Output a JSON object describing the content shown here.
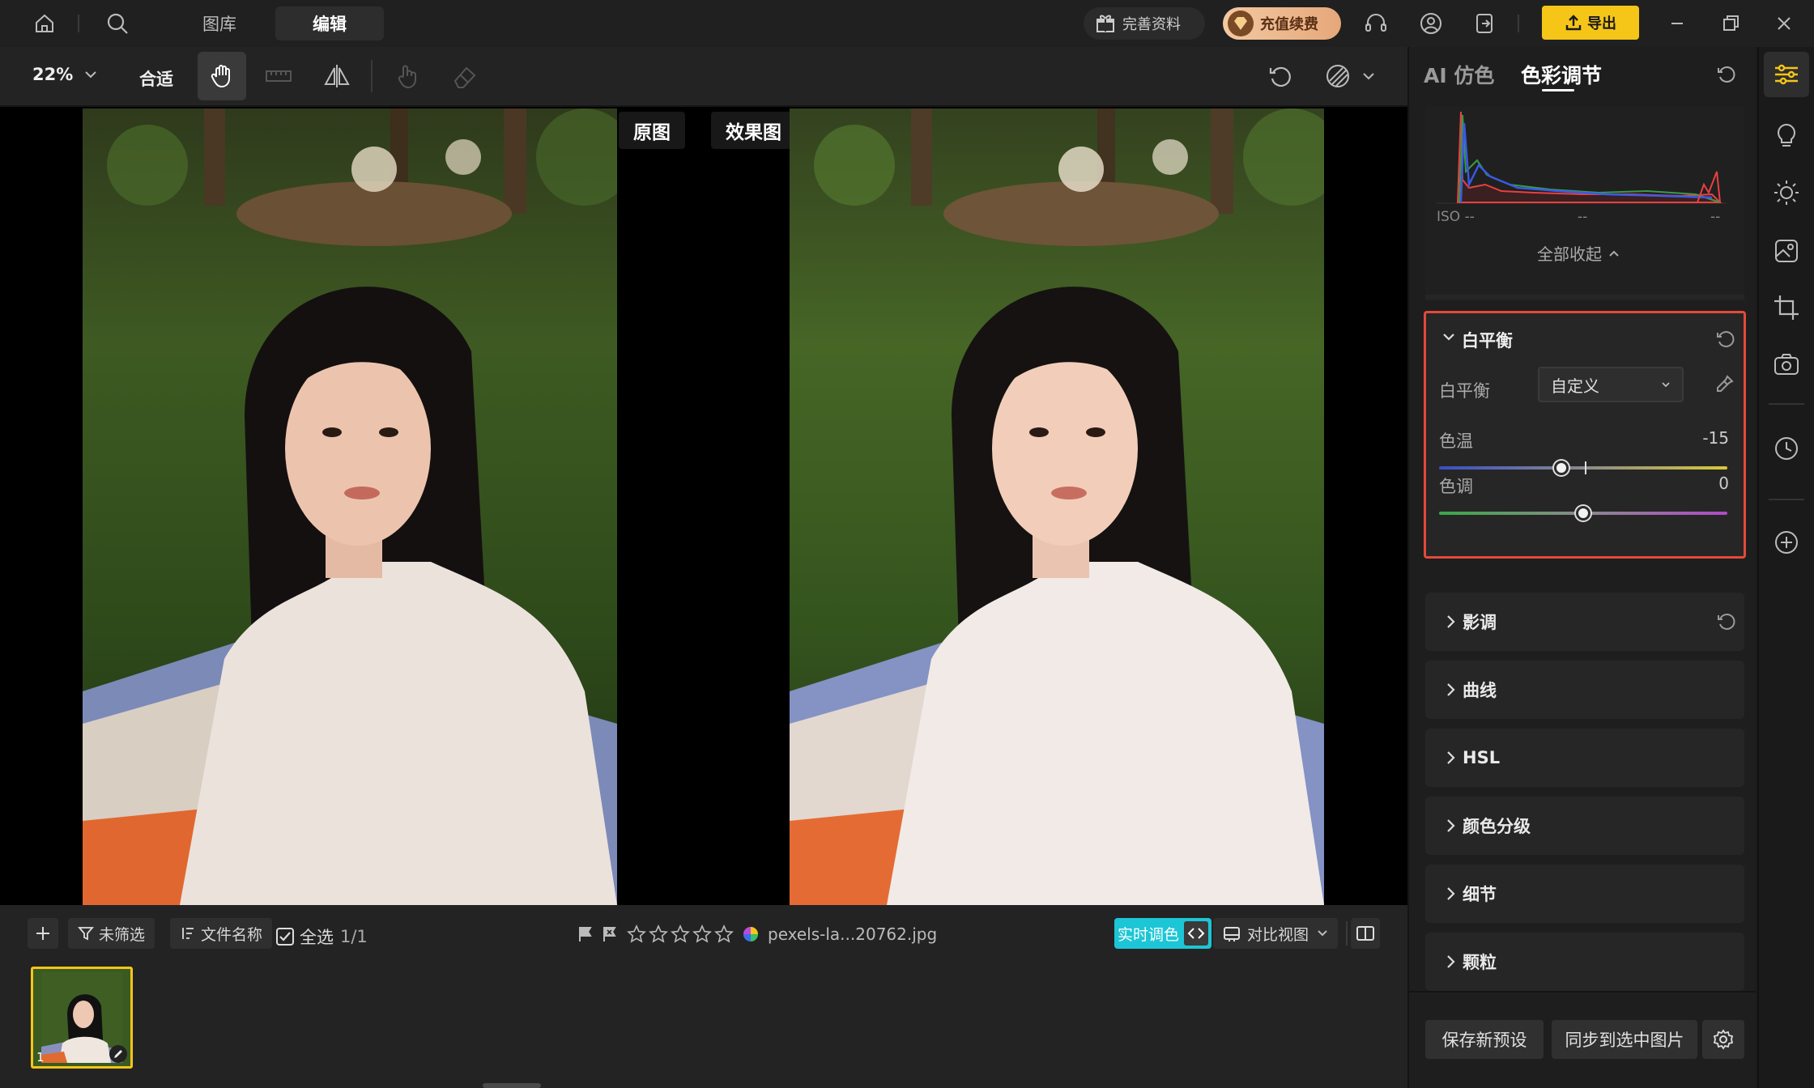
{
  "topbar": {
    "nav_library": "图库",
    "nav_edit": "编辑",
    "profile_btn": "完善资料",
    "vip_btn": "充值续费",
    "export_btn": "导出"
  },
  "toolbar": {
    "zoom": "22%",
    "fit": "合适"
  },
  "canvas": {
    "original_label": "原图",
    "effect_label": "效果图"
  },
  "filmbar": {
    "filter": "未筛选",
    "sort": "文件名称",
    "select_all": "全选",
    "count": "1/1",
    "rating": 0,
    "filename": "pexels-la...20762.jpg",
    "live_color": "实时调色",
    "compare_view": "对比视图",
    "thumb_index": "1"
  },
  "panel": {
    "tab_ai": "AI 仿色",
    "tab_color": "色彩调节",
    "iso": "ISO --",
    "exif_mid": "--",
    "exif_right": "--",
    "collapse_all": "全部收起",
    "white_balance": {
      "title": "白平衡",
      "mode_label": "白平衡",
      "mode_value": "自定义",
      "temp_label": "色温",
      "temp_value": "-15",
      "tint_label": "色调",
      "tint_value": "0"
    },
    "sections": {
      "tone": "影调",
      "curve": "曲线",
      "hsl": "HSL",
      "grading": "颜色分级",
      "detail": "细节",
      "grain": "颗粒"
    },
    "save_preset": "保存新预设",
    "sync": "同步到选中图片"
  },
  "colors": {
    "accent_yellow": "#f5c518",
    "highlight_red": "#e24a3b",
    "live_cyan": "#1cc6d6"
  }
}
